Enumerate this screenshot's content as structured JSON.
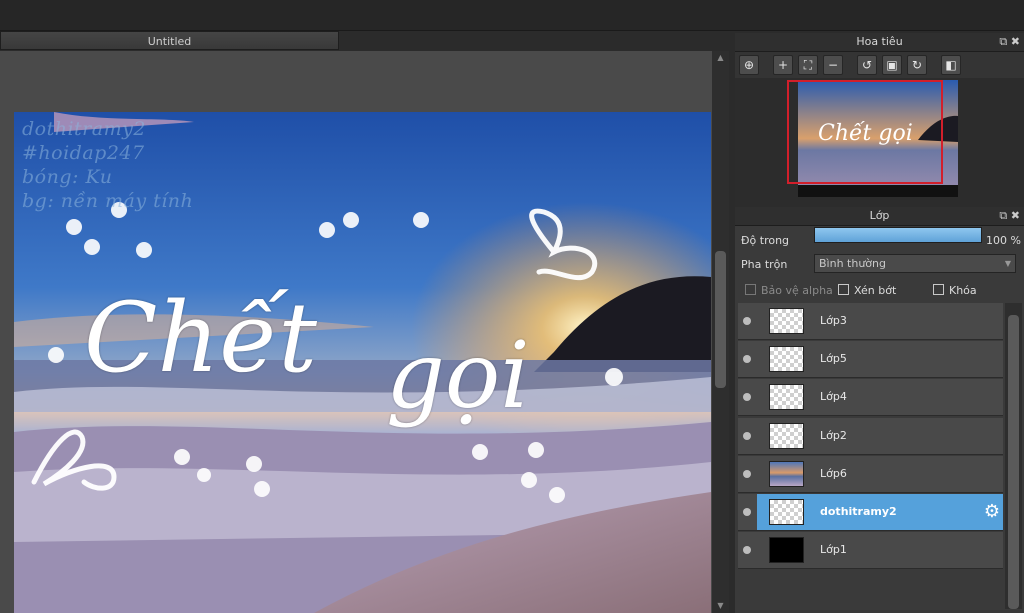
{
  "document": {
    "tab_title": "Untitled"
  },
  "canvas": {
    "watermark_lines": [
      "dothitramy2",
      "#hoidap247",
      "bóng: Ku",
      "bg: nền máy tính"
    ],
    "title_word_1": "Chết",
    "title_word_2": "gọi"
  },
  "navigator": {
    "title": "Hoa tiêu",
    "mini_title": "Chết gọi",
    "tools": [
      "zoom-fit-icon",
      "zoom-in-icon",
      "fit-window-icon",
      "zoom-out-icon",
      "rotate-left-icon",
      "actual-size-icon",
      "rotate-right-icon",
      "flip-icon"
    ]
  },
  "layers_panel": {
    "title": "Lớp",
    "opacity_label": "Độ trong",
    "opacity_value": "100 %",
    "opacity_fraction": 1.0,
    "blend_label": "Pha trộn",
    "blend_value": "Bình thường",
    "protect_alpha_label": "Bảo vệ alpha",
    "clip_label": "Xén bớt",
    "lock_label": "Khóa",
    "layers": [
      {
        "name": "Lớp3",
        "thumb": "transparent",
        "selected": false
      },
      {
        "name": "Lớp5",
        "thumb": "transparent",
        "selected": false
      },
      {
        "name": "Lớp4",
        "thumb": "transparent",
        "selected": false
      },
      {
        "name": "Lớp2",
        "thumb": "transparent",
        "selected": false
      },
      {
        "name": "Lớp6",
        "thumb": "photo",
        "selected": false
      },
      {
        "name": "dothitramy2",
        "thumb": "transparent",
        "selected": true
      },
      {
        "name": "Lớp1",
        "thumb": "black",
        "selected": false
      }
    ]
  },
  "colors": {
    "selection": "#55a1db",
    "navigator_frame": "#d21f2b"
  }
}
